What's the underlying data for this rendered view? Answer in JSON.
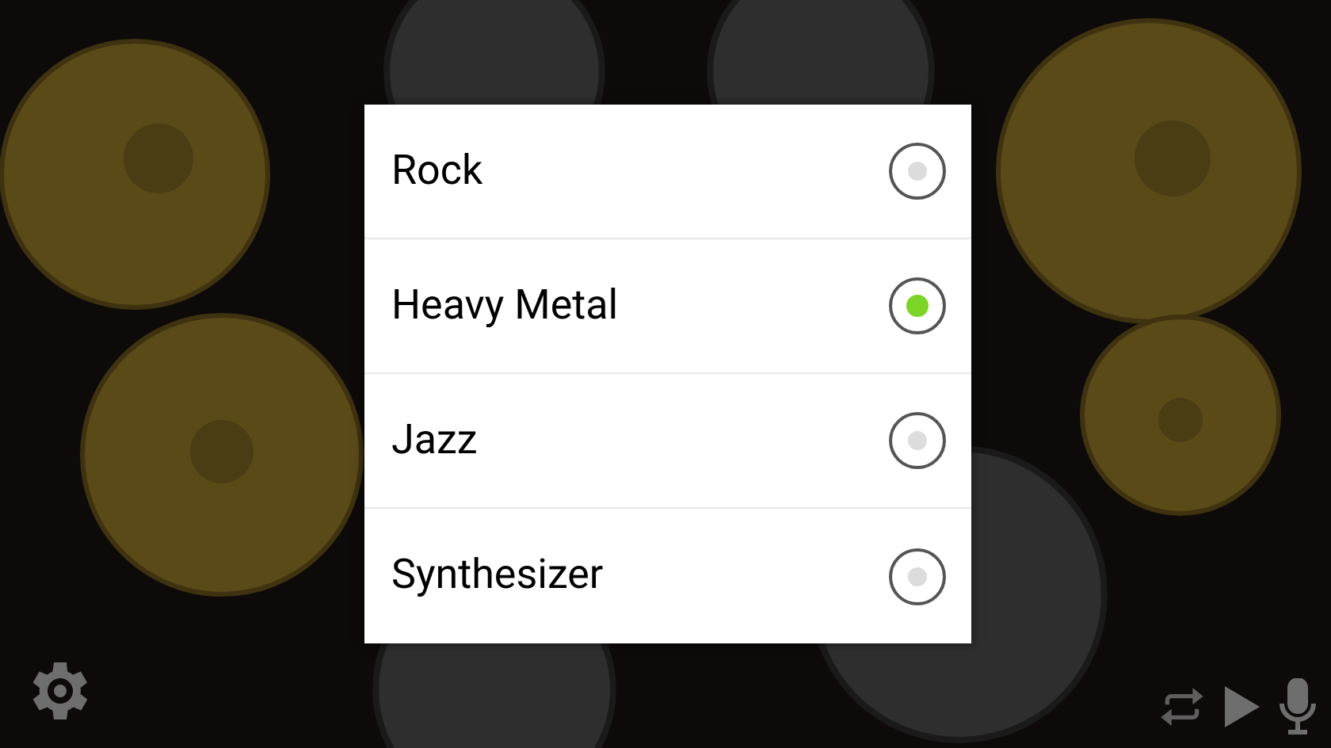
{
  "options": [
    {
      "label": "Rock",
      "selected": false
    },
    {
      "label": "Heavy Metal",
      "selected": true
    },
    {
      "label": "Jazz",
      "selected": false
    },
    {
      "label": "Synthesizer",
      "selected": false
    }
  ]
}
